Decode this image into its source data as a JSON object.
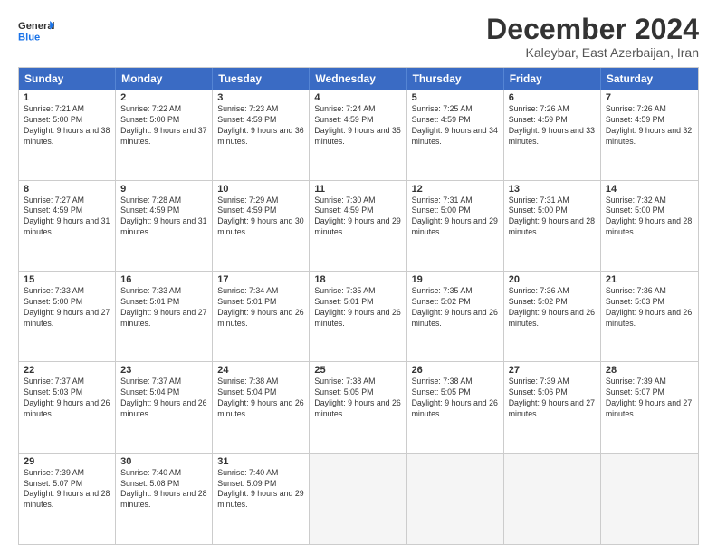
{
  "logo": {
    "line1": "General",
    "line2": "Blue"
  },
  "title": "December 2024",
  "subtitle": "Kaleybar, East Azerbaijan, Iran",
  "header_days": [
    "Sunday",
    "Monday",
    "Tuesday",
    "Wednesday",
    "Thursday",
    "Friday",
    "Saturday"
  ],
  "weeks": [
    [
      {
        "day": "1",
        "sunrise": "7:21 AM",
        "sunset": "5:00 PM",
        "daylight": "9 hours and 38 minutes."
      },
      {
        "day": "2",
        "sunrise": "7:22 AM",
        "sunset": "5:00 PM",
        "daylight": "9 hours and 37 minutes."
      },
      {
        "day": "3",
        "sunrise": "7:23 AM",
        "sunset": "4:59 PM",
        "daylight": "9 hours and 36 minutes."
      },
      {
        "day": "4",
        "sunrise": "7:24 AM",
        "sunset": "4:59 PM",
        "daylight": "9 hours and 35 minutes."
      },
      {
        "day": "5",
        "sunrise": "7:25 AM",
        "sunset": "4:59 PM",
        "daylight": "9 hours and 34 minutes."
      },
      {
        "day": "6",
        "sunrise": "7:26 AM",
        "sunset": "4:59 PM",
        "daylight": "9 hours and 33 minutes."
      },
      {
        "day": "7",
        "sunrise": "7:26 AM",
        "sunset": "4:59 PM",
        "daylight": "9 hours and 32 minutes."
      }
    ],
    [
      {
        "day": "8",
        "sunrise": "7:27 AM",
        "sunset": "4:59 PM",
        "daylight": "9 hours and 31 minutes."
      },
      {
        "day": "9",
        "sunrise": "7:28 AM",
        "sunset": "4:59 PM",
        "daylight": "9 hours and 31 minutes."
      },
      {
        "day": "10",
        "sunrise": "7:29 AM",
        "sunset": "4:59 PM",
        "daylight": "9 hours and 30 minutes."
      },
      {
        "day": "11",
        "sunrise": "7:30 AM",
        "sunset": "4:59 PM",
        "daylight": "9 hours and 29 minutes."
      },
      {
        "day": "12",
        "sunrise": "7:31 AM",
        "sunset": "5:00 PM",
        "daylight": "9 hours and 29 minutes."
      },
      {
        "day": "13",
        "sunrise": "7:31 AM",
        "sunset": "5:00 PM",
        "daylight": "9 hours and 28 minutes."
      },
      {
        "day": "14",
        "sunrise": "7:32 AM",
        "sunset": "5:00 PM",
        "daylight": "9 hours and 28 minutes."
      }
    ],
    [
      {
        "day": "15",
        "sunrise": "7:33 AM",
        "sunset": "5:00 PM",
        "daylight": "9 hours and 27 minutes."
      },
      {
        "day": "16",
        "sunrise": "7:33 AM",
        "sunset": "5:01 PM",
        "daylight": "9 hours and 27 minutes."
      },
      {
        "day": "17",
        "sunrise": "7:34 AM",
        "sunset": "5:01 PM",
        "daylight": "9 hours and 26 minutes."
      },
      {
        "day": "18",
        "sunrise": "7:35 AM",
        "sunset": "5:01 PM",
        "daylight": "9 hours and 26 minutes."
      },
      {
        "day": "19",
        "sunrise": "7:35 AM",
        "sunset": "5:02 PM",
        "daylight": "9 hours and 26 minutes."
      },
      {
        "day": "20",
        "sunrise": "7:36 AM",
        "sunset": "5:02 PM",
        "daylight": "9 hours and 26 minutes."
      },
      {
        "day": "21",
        "sunrise": "7:36 AM",
        "sunset": "5:03 PM",
        "daylight": "9 hours and 26 minutes."
      }
    ],
    [
      {
        "day": "22",
        "sunrise": "7:37 AM",
        "sunset": "5:03 PM",
        "daylight": "9 hours and 26 minutes."
      },
      {
        "day": "23",
        "sunrise": "7:37 AM",
        "sunset": "5:04 PM",
        "daylight": "9 hours and 26 minutes."
      },
      {
        "day": "24",
        "sunrise": "7:38 AM",
        "sunset": "5:04 PM",
        "daylight": "9 hours and 26 minutes."
      },
      {
        "day": "25",
        "sunrise": "7:38 AM",
        "sunset": "5:05 PM",
        "daylight": "9 hours and 26 minutes."
      },
      {
        "day": "26",
        "sunrise": "7:38 AM",
        "sunset": "5:05 PM",
        "daylight": "9 hours and 26 minutes."
      },
      {
        "day": "27",
        "sunrise": "7:39 AM",
        "sunset": "5:06 PM",
        "daylight": "9 hours and 27 minutes."
      },
      {
        "day": "28",
        "sunrise": "7:39 AM",
        "sunset": "5:07 PM",
        "daylight": "9 hours and 27 minutes."
      }
    ],
    [
      {
        "day": "29",
        "sunrise": "7:39 AM",
        "sunset": "5:07 PM",
        "daylight": "9 hours and 28 minutes."
      },
      {
        "day": "30",
        "sunrise": "7:40 AM",
        "sunset": "5:08 PM",
        "daylight": "9 hours and 28 minutes."
      },
      {
        "day": "31",
        "sunrise": "7:40 AM",
        "sunset": "5:09 PM",
        "daylight": "9 hours and 29 minutes."
      },
      {
        "day": "",
        "sunrise": "",
        "sunset": "",
        "daylight": ""
      },
      {
        "day": "",
        "sunrise": "",
        "sunset": "",
        "daylight": ""
      },
      {
        "day": "",
        "sunrise": "",
        "sunset": "",
        "daylight": ""
      },
      {
        "day": "",
        "sunrise": "",
        "sunset": "",
        "daylight": ""
      }
    ]
  ]
}
